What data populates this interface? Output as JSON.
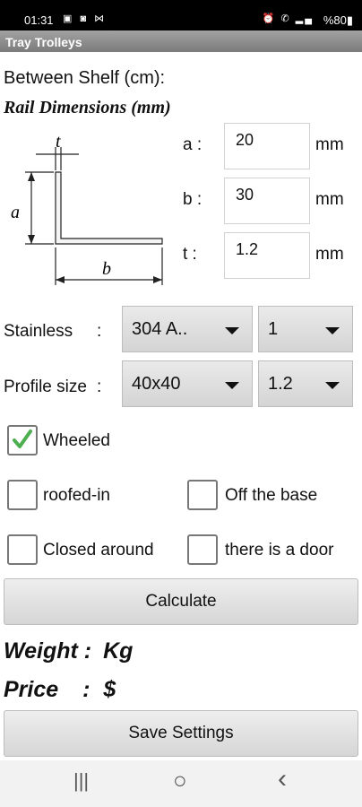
{
  "status": {
    "time": "01:31",
    "left_icons": "▣ ◙ ⋈",
    "right_icons": "⏰ ✆ ▂▄",
    "battery": "%80▮"
  },
  "app": {
    "title": "Tray Trolleys"
  },
  "form": {
    "between_shelf_label": "Between Shelf (cm):",
    "rail_title": "Rail Dimensions (mm)",
    "diagram": {
      "t": "t",
      "a": "a",
      "b": "b"
    },
    "dims": [
      {
        "label": "a :",
        "value": "20",
        "unit": "mm"
      },
      {
        "label": "b :",
        "value": "30",
        "unit": "mm"
      },
      {
        "label": "t :",
        "value": "1.2",
        "unit": "mm"
      }
    ],
    "stainless": {
      "label": "Stainless",
      "colon": ":",
      "selected1": "304 A..",
      "selected2": "1"
    },
    "profile": {
      "label": "Profile size",
      "colon": ":",
      "selected1": "40x40",
      "selected2": "1.2"
    },
    "checkboxes": {
      "wheeled": {
        "label": "Wheeled",
        "checked": true
      },
      "roofed": {
        "label": "roofed-in",
        "checked": false
      },
      "off_base": {
        "label": "Off the base",
        "checked": false
      },
      "closed": {
        "label": "Closed around",
        "checked": false
      },
      "door": {
        "label": "there is a door",
        "checked": false
      }
    },
    "calculate_label": "Calculate"
  },
  "results": {
    "weight_label": "Weight :",
    "weight_unit": "Kg",
    "price_label": "Price",
    "price_colon": ":",
    "price_unit": "$"
  },
  "save_label": "Save Settings",
  "nav": {
    "recents": "|||",
    "home": "○",
    "back": "‹"
  },
  "colors": {
    "check": "#4caf50",
    "titlebar": "#8e8e8e"
  }
}
